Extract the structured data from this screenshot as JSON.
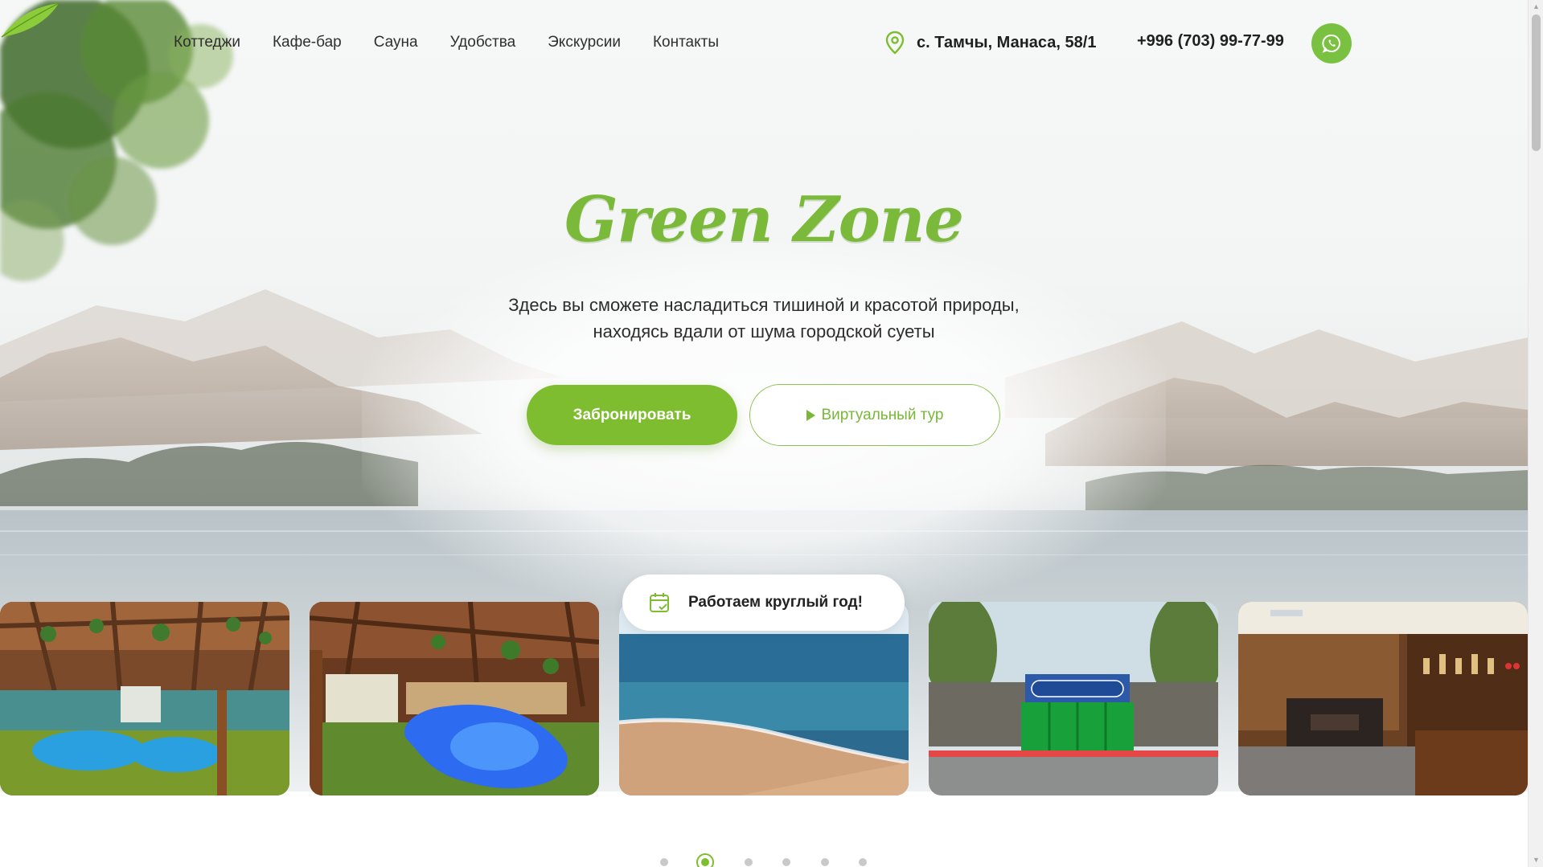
{
  "nav": {
    "items": [
      "Коттеджи",
      "Кафе-бар",
      "Сауна",
      "Удобства",
      "Экскурсии",
      "Контакты"
    ]
  },
  "contacts": {
    "address": "с. Тамчы, Манаса, 58/1",
    "phone": "+996 (703) 99-77-99",
    "address_icon": "location-pin-icon",
    "messenger_icon": "whatsapp-icon"
  },
  "hero": {
    "brand": "Green Zone",
    "tagline_line1": "Здесь вы сможете насладиться тишиной и красотой природы,",
    "tagline_line2": "находясь вдали от шума городской суеты",
    "book_label": "Забронировать",
    "tour_label": "Виртуальный тур"
  },
  "badge": {
    "text": "Работаем круглый год!",
    "icon": "calendar-check-icon"
  },
  "gallery": {
    "photos": [
      "pool-under-pergola",
      "illuminated-pool",
      "lake-beach",
      "green-zone-gate",
      "cafe-bar-interior"
    ]
  },
  "pagination": {
    "count": 6,
    "active_index": 1
  },
  "colors": {
    "accent": "#7ebd2f",
    "brand": "#7bb93a",
    "whatsapp": "#7ac142"
  }
}
